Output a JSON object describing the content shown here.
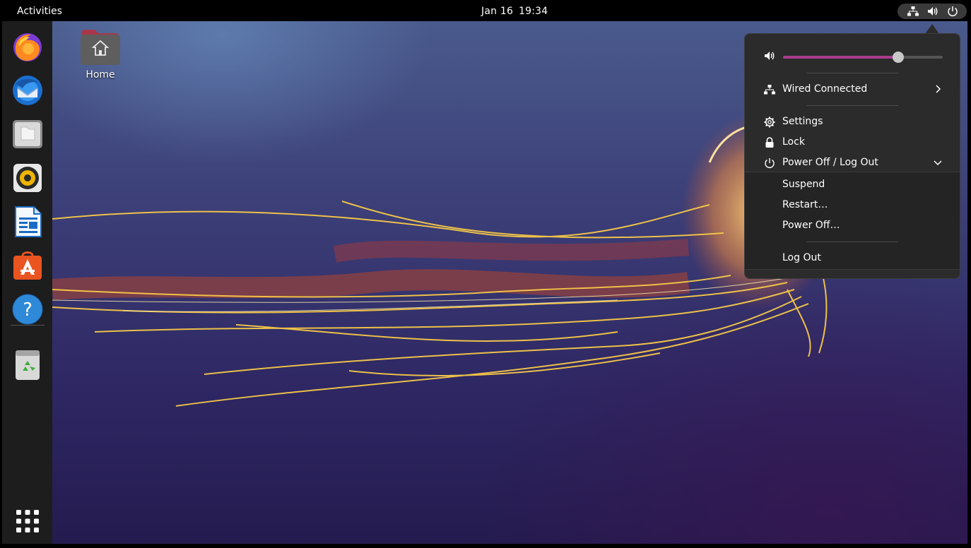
{
  "topbar": {
    "activities": "Activities",
    "date": "Jan 16",
    "time": "19:34",
    "tray_icons": [
      "network-wired-icon",
      "volume-icon",
      "power-icon"
    ]
  },
  "dock": {
    "items": [
      {
        "name": "firefox",
        "icon": "firefox-icon"
      },
      {
        "name": "thunderbird",
        "icon": "thunderbird-icon"
      },
      {
        "name": "files",
        "icon": "files-icon"
      },
      {
        "name": "rhythmbox",
        "icon": "rhythmbox-icon"
      },
      {
        "name": "libreoffice-writer",
        "icon": "writer-icon"
      },
      {
        "name": "ubuntu-software",
        "icon": "software-icon"
      },
      {
        "name": "help",
        "icon": "help-icon"
      },
      {
        "name": "trash",
        "icon": "trash-icon"
      }
    ],
    "show_apps_icon": "apps-grid-icon"
  },
  "desktop": {
    "home_label": "Home"
  },
  "system_menu": {
    "volume_level": 0.72,
    "network_label": "Wired Connected",
    "settings_label": "Settings",
    "lock_label": "Lock",
    "power_label": "Power Off / Log Out",
    "power_submenu": {
      "suspend": "Suspend",
      "restart": "Restart…",
      "power_off": "Power Off…",
      "log_out": "Log Out"
    }
  },
  "colors": {
    "accent": "#a83c8e",
    "panel": "#2b2b2b",
    "dock": "#1d1d1d"
  }
}
